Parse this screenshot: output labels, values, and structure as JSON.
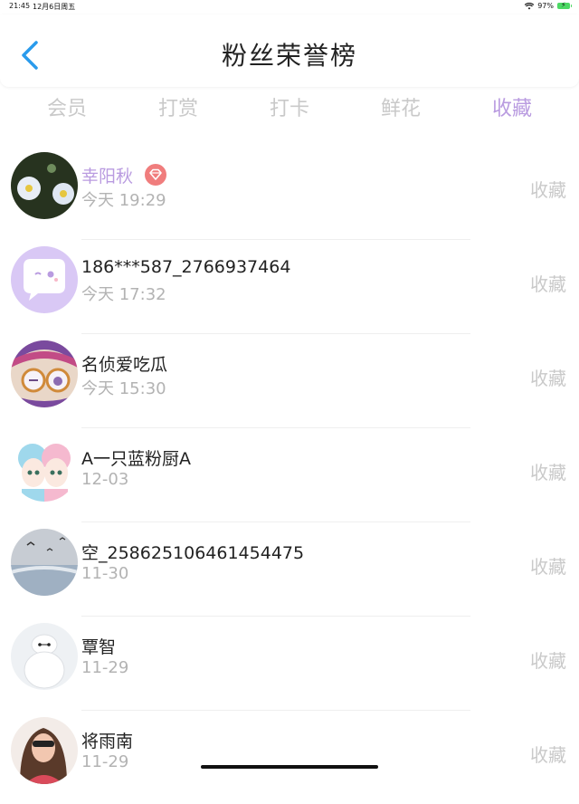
{
  "status_bar": {
    "time": "21:45",
    "date": "12月6日周五",
    "battery": "97%"
  },
  "header": {
    "title": "粉丝荣誉榜"
  },
  "tabs": [
    {
      "label": "会员"
    },
    {
      "label": "打赏"
    },
    {
      "label": "打卡"
    },
    {
      "label": "鲜花"
    },
    {
      "label": "收藏",
      "active": true
    }
  ],
  "rows": [
    {
      "name": "幸阳秋",
      "time": "今天 19:29",
      "action": "收藏",
      "highlight": true,
      "badge": "diamond-badge-icon"
    },
    {
      "name": "186***587_2766937464",
      "time": "今天 17:32",
      "action": "收藏"
    },
    {
      "name": "名侦爱吃瓜",
      "time": "今天 15:30",
      "action": "收藏"
    },
    {
      "name": "A一只蓝粉厨A",
      "time": "12-03",
      "action": "收藏"
    },
    {
      "name": "空_258625106461454475",
      "time": "11-30",
      "action": "收藏"
    },
    {
      "name": "覃智",
      "time": "11-29",
      "action": "收藏"
    },
    {
      "name": "将雨南",
      "time": "11-29",
      "action": "收藏"
    }
  ],
  "colors": {
    "accent": "#b99be0",
    "back_arrow": "#2a9bec",
    "muted": "#c9c9c9",
    "badge": "#f07d7d"
  }
}
